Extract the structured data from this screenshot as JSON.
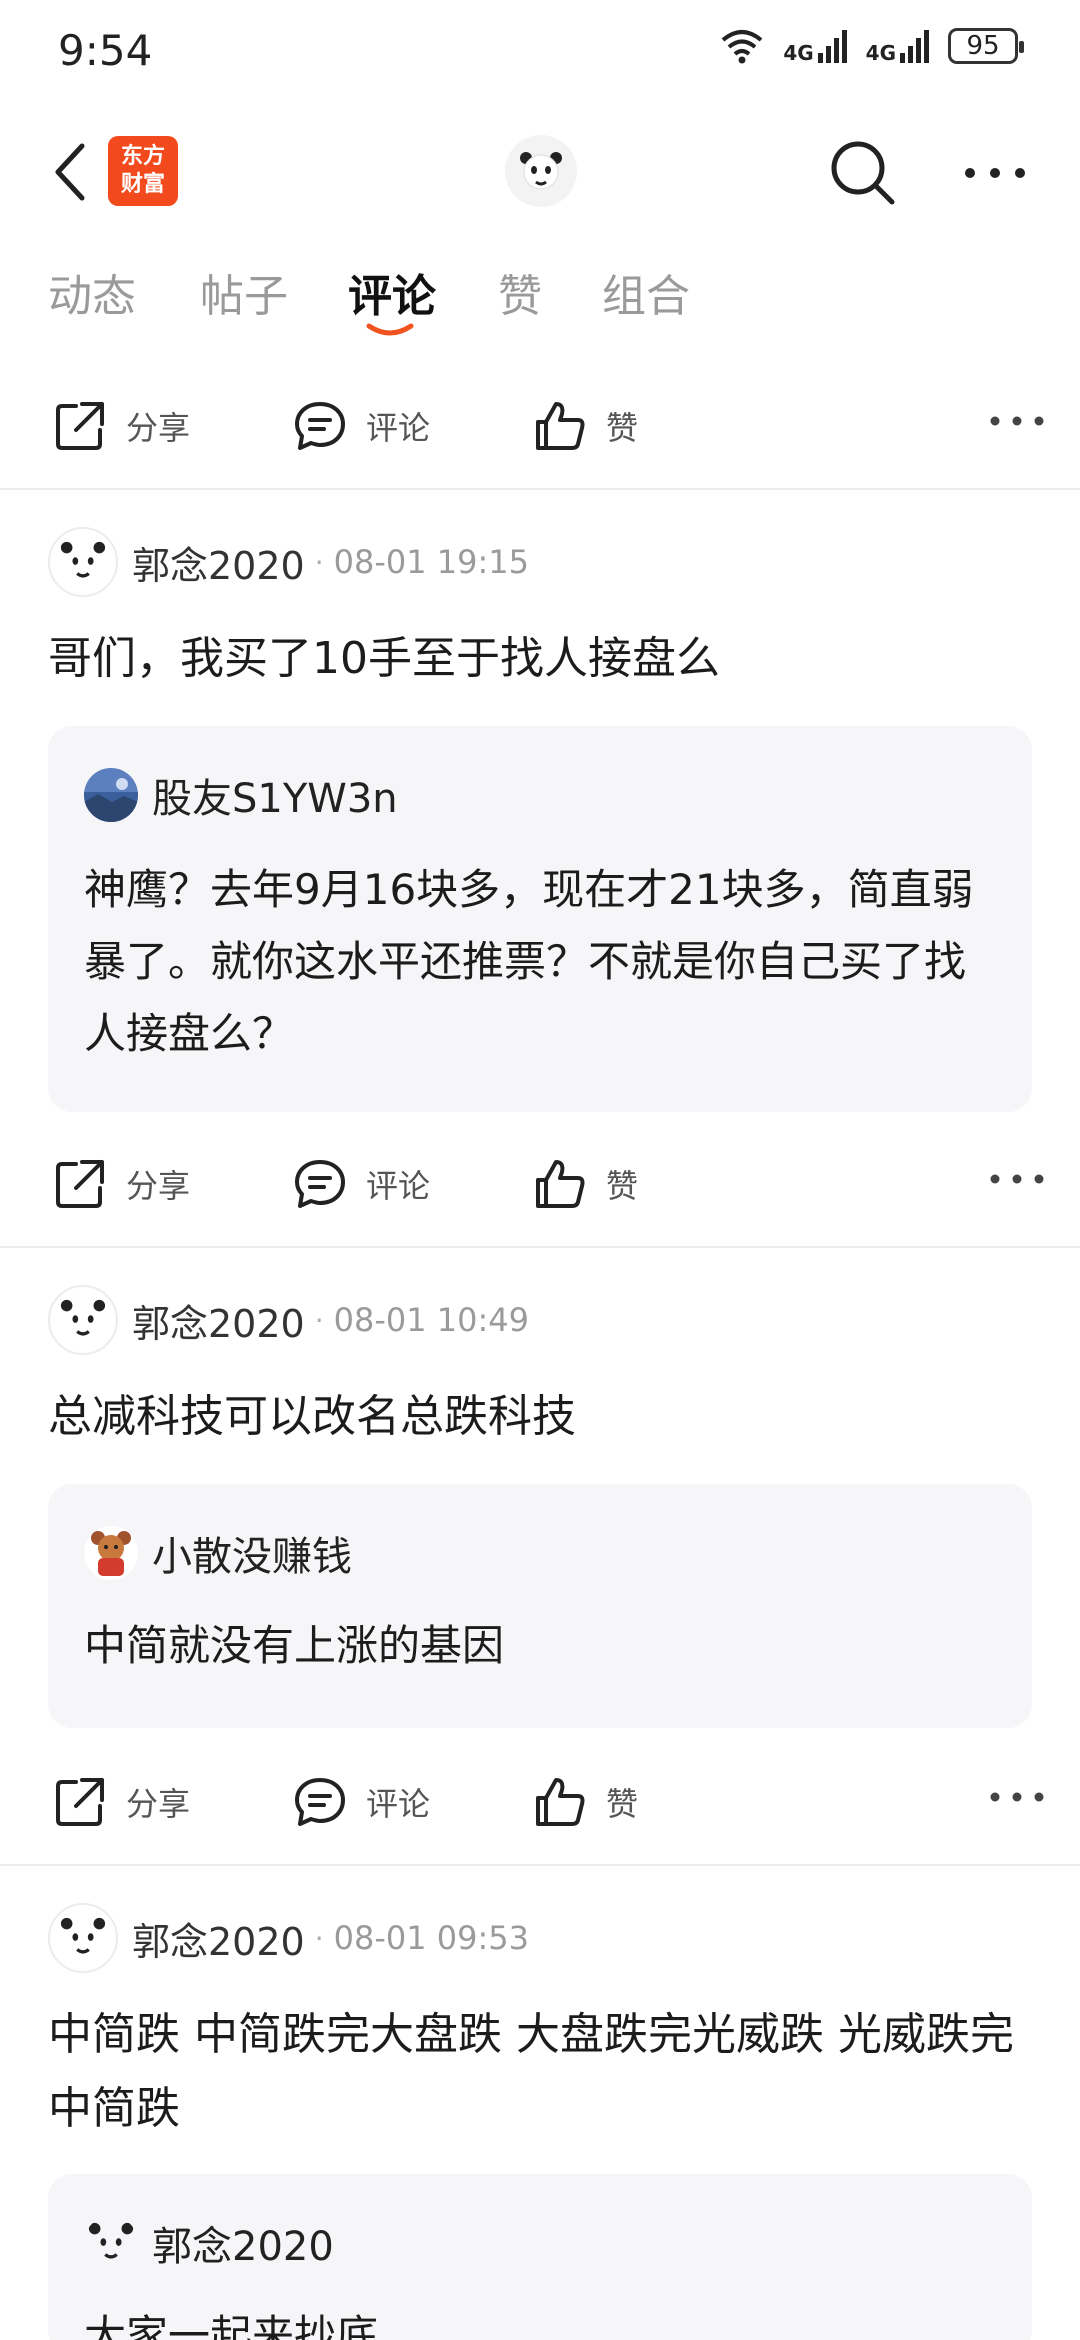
{
  "status_bar": {
    "time": "9:54",
    "battery": "95",
    "net1": "4G",
    "net2": "4G"
  },
  "header": {
    "logo_line1": "东方",
    "logo_line2": "财富"
  },
  "tabs": [
    {
      "label": "动态"
    },
    {
      "label": "帖子"
    },
    {
      "label": "评论"
    },
    {
      "label": "赞"
    },
    {
      "label": "组合"
    }
  ],
  "actions": {
    "share": "分享",
    "comment": "评论",
    "like": "赞"
  },
  "posts": [
    {
      "author": "郭念2020",
      "time": "08-01 19:15",
      "text": "哥们，我买了10手至于找人接盘么",
      "quote": {
        "author": "股友S1YW3n",
        "text": "神鹰？去年9月16块多，现在才21块多，简直弱暴了。就你这水平还推票？不就是你自己买了找人接盘么？"
      }
    },
    {
      "author": "郭念2020",
      "time": "08-01 10:49",
      "text": "总减科技可以改名总跌科技",
      "quote": {
        "author": "小散没赚钱",
        "text": "中简就没有上涨的基因"
      }
    },
    {
      "author": "郭念2020",
      "time": "08-01 09:53",
      "text": "中简跌 中简跌完大盘跌 大盘跌完光威跌 光威跌完中简跌",
      "quote": {
        "author": "郭念2020",
        "text": "大家一起来抄底"
      }
    }
  ],
  "colors": {
    "accent": "#f24a1d",
    "tab_indicator": "#f0531f"
  }
}
